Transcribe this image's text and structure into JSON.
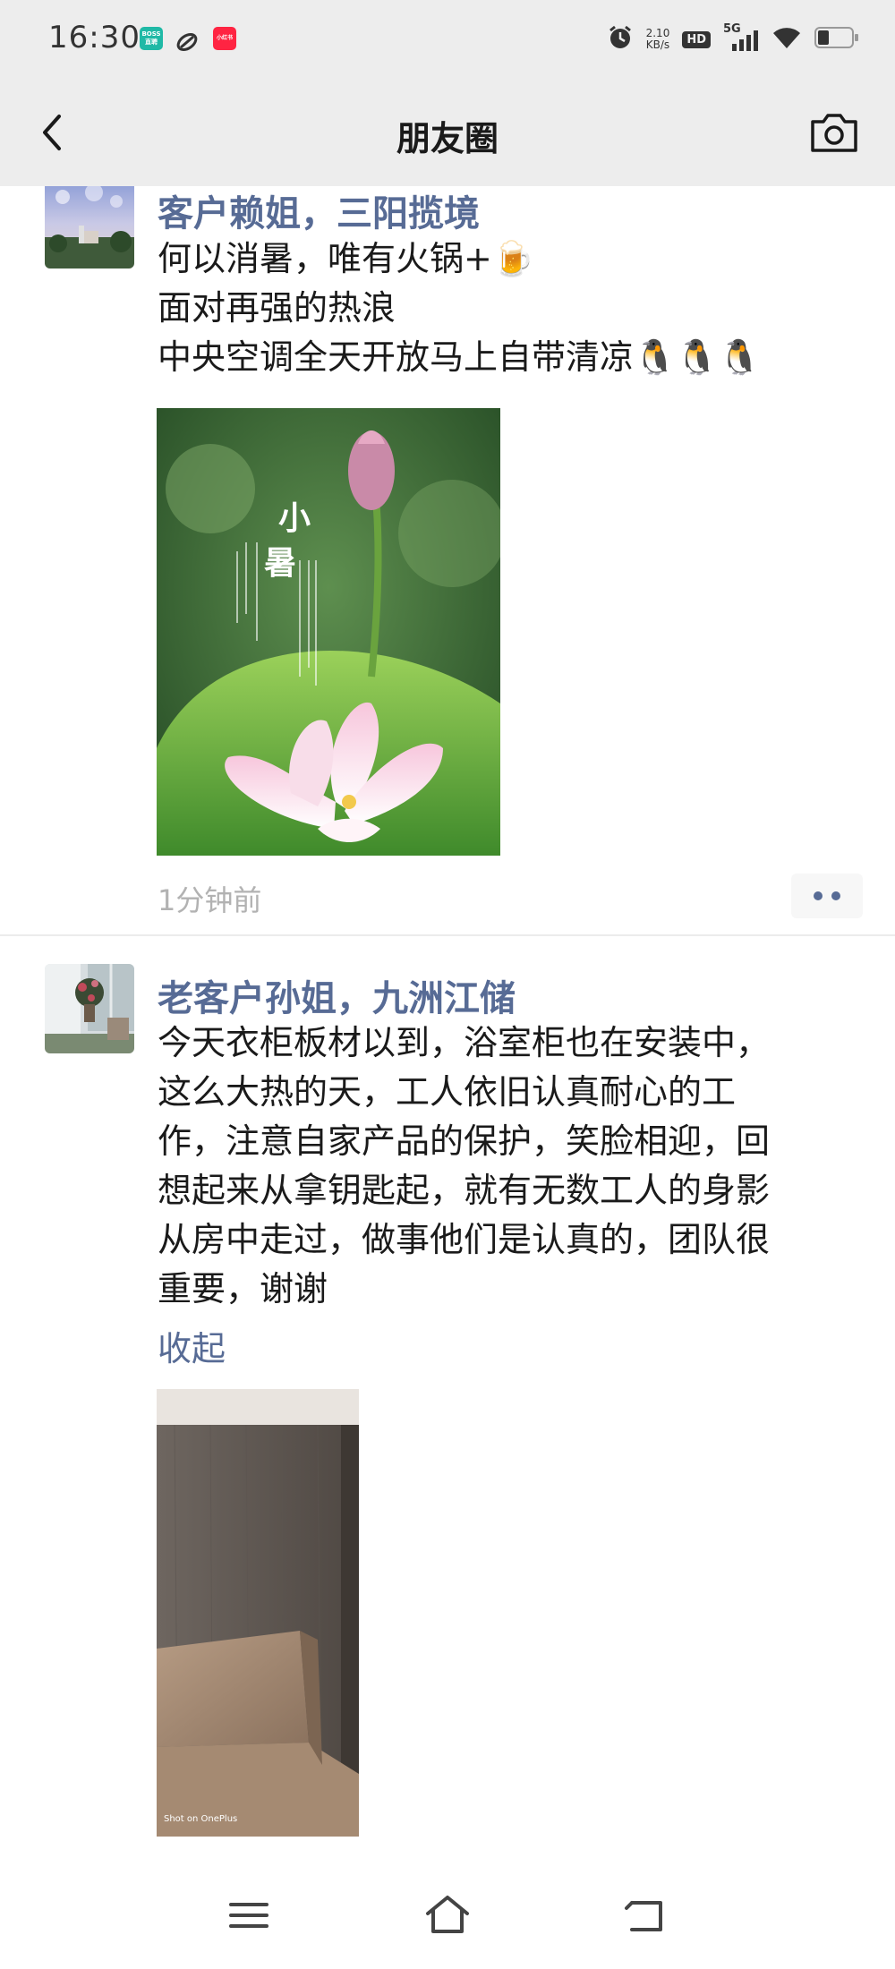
{
  "status_bar": {
    "time": "16:30",
    "apps": [
      {
        "name": "boss-zhipin-app-icon",
        "label": "BOSS直聘",
        "color": "#1fb9a6"
      },
      {
        "name": "link-app-icon",
        "label": "",
        "color": "#333333"
      },
      {
        "name": "xiaohongshu-app-icon",
        "label": "小红书",
        "color": "#ff2442"
      }
    ],
    "net_speed_value": "2.10",
    "net_speed_unit": "KB/s",
    "hd_label": "HD",
    "signal_label": "5G"
  },
  "nav": {
    "title": "朋友圈",
    "back_icon": "chevron-left-icon",
    "camera_icon": "camera-icon"
  },
  "posts": [
    {
      "author": "客户赖姐，三阳揽境",
      "text_lines": [
        "何以消暑，唯有火锅+🍺",
        "面对再强的热浪",
        "中央空调全天开放马上自带清凉🐧🐧🐧"
      ],
      "image_title": "小暑",
      "time": "1分钟前"
    },
    {
      "author": "老客户孙姐，九洲江储",
      "text_lines": [
        "今天衣柜板材以到，浴室柜也在安装中，",
        "这么大热的天，工人依旧认真耐心的工",
        "作，注意自家产品的保护，笑脸相迎，回",
        "想起来从拿钥匙起，就有无数工人的身影",
        "从房中走过，做事他们是认真的，团队很",
        "重要，谢谢"
      ],
      "collapse_label": "收起",
      "image_caption": "Shot on OnePlus"
    }
  ],
  "colors": {
    "link_blue": "#576b95",
    "bar_gray": "#ededed",
    "time_gray": "#b2b2b2"
  },
  "bottom_nav": {
    "icons": [
      "menu-icon",
      "home-icon",
      "back-icon"
    ]
  }
}
